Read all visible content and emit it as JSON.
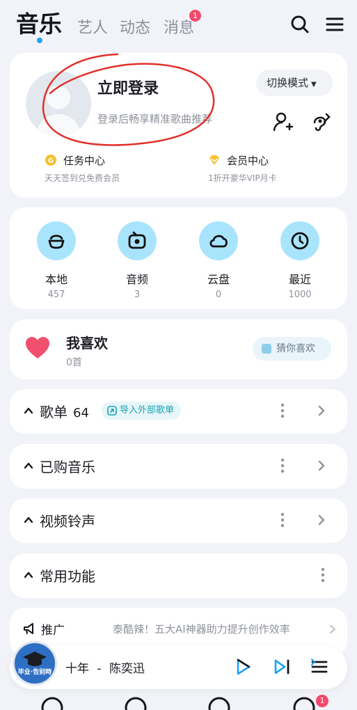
{
  "topnav": {
    "tabs": [
      {
        "label": "音乐"
      },
      {
        "label": "艺人"
      },
      {
        "label": "动态"
      },
      {
        "label": "消息",
        "badge": "1"
      }
    ],
    "icons": [
      "search-icon",
      "menu-icon"
    ]
  },
  "login": {
    "title": "立即登录",
    "subtitle": "登录后畅享精准歌曲推荐",
    "mode_button": "切换模式",
    "features": [
      {
        "title": "任务中心",
        "subtitle": "天天签到兑免费会员"
      },
      {
        "title": "会员中心",
        "subtitle": "1折开豪华VIP月卡"
      }
    ]
  },
  "quick": [
    {
      "label": "本地",
      "count": "457",
      "icon": "local-music-icon"
    },
    {
      "label": "音频",
      "count": "3",
      "icon": "audio-icon"
    },
    {
      "label": "云盘",
      "count": "0",
      "icon": "cloud-icon"
    },
    {
      "label": "最近",
      "count": "1000",
      "icon": "clock-icon"
    }
  ],
  "favorites": {
    "title": "我喜欢",
    "count": "0首",
    "guess_button": "猜你喜欢"
  },
  "sections": [
    {
      "title": "歌单",
      "count": "64",
      "import_label": "导入外部歌单"
    },
    {
      "title": "已购音乐"
    },
    {
      "title": "视频铃声"
    },
    {
      "title": "常用功能"
    }
  ],
  "promo": {
    "label": "推广",
    "text": "泰酷辣！五大AI神器助力提升创作效率"
  },
  "player": {
    "song": "十年",
    "separator": "-",
    "artist": "陈奕迅",
    "disc_text": "毕业·告别時"
  },
  "bottom_nav": {
    "badge": "1"
  },
  "colors": {
    "accent": "#1ea2f2",
    "badge": "#f5496a",
    "quick_circle": "#a9e4fd",
    "heart": "#f0506e",
    "annotation": "#e0302a"
  }
}
